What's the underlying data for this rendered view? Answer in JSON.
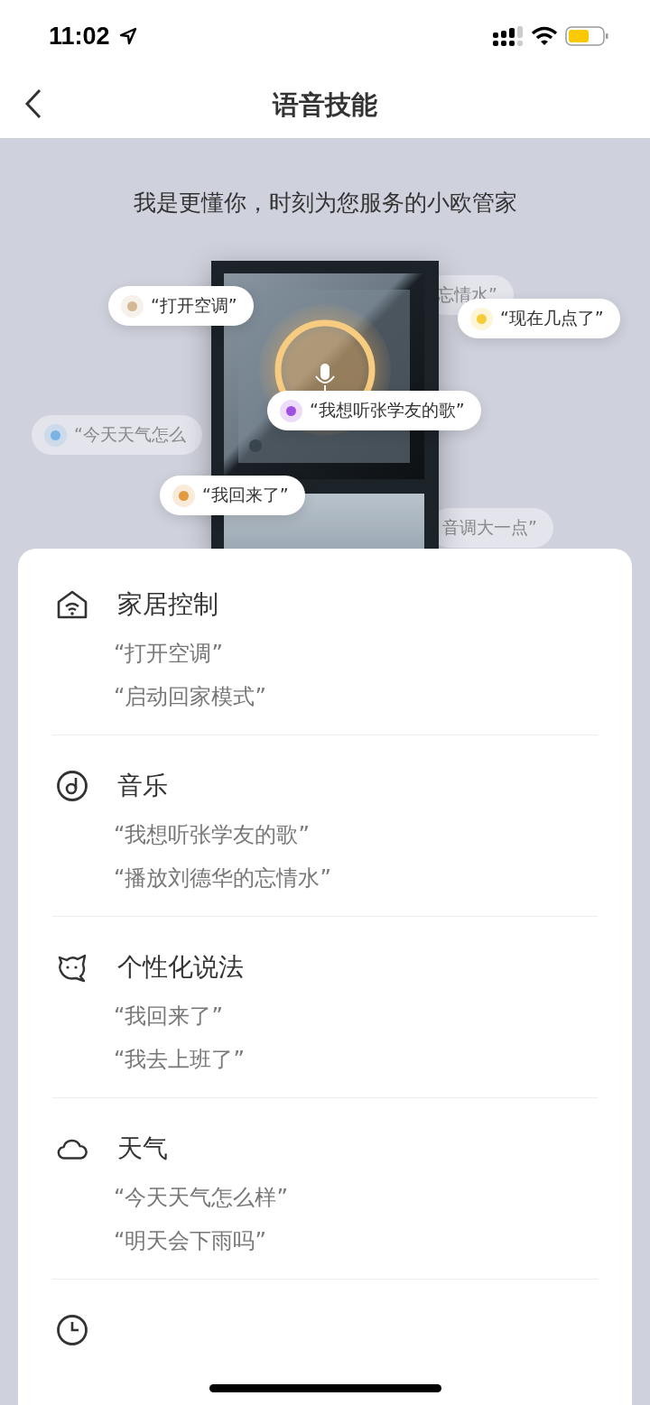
{
  "status_bar": {
    "time": "11:02"
  },
  "header": {
    "title": "语音技能"
  },
  "hero": {
    "tagline": "我是更懂你，时刻为您服务的小欧管家",
    "bubbles": [
      {
        "text": "“打开空调”",
        "color": "#d4b896",
        "kind": "front"
      },
      {
        "text": "忘情水”",
        "kind": "back"
      },
      {
        "text": "“现在几点了”",
        "color": "#f5cc3a",
        "kind": "front"
      },
      {
        "text": "“我想听张学友的歌”",
        "color": "#a050e0",
        "kind": "front"
      },
      {
        "text": "“今天天气怎么",
        "color": "#7ab4e4",
        "kind": "back"
      },
      {
        "text": "“我回来了”",
        "color": "#e09a40",
        "kind": "front"
      },
      {
        "text": "音调大一点”",
        "kind": "back"
      }
    ]
  },
  "skills": [
    {
      "kind": "home",
      "title": "家居控制",
      "examples": [
        "“打开空调”",
        "“启动回家模式”"
      ]
    },
    {
      "kind": "music",
      "title": "音乐",
      "examples": [
        "“我想听张学友的歌”",
        "“播放刘德华的忘情水”"
      ]
    },
    {
      "kind": "persona",
      "title": "个性化说法",
      "examples": [
        "“我回来了”",
        "“我去上班了”"
      ]
    },
    {
      "kind": "weather",
      "title": "天气",
      "examples": [
        "“今天天气怎么样”",
        "“明天会下雨吗”"
      ]
    },
    {
      "kind": "clock"
    }
  ]
}
